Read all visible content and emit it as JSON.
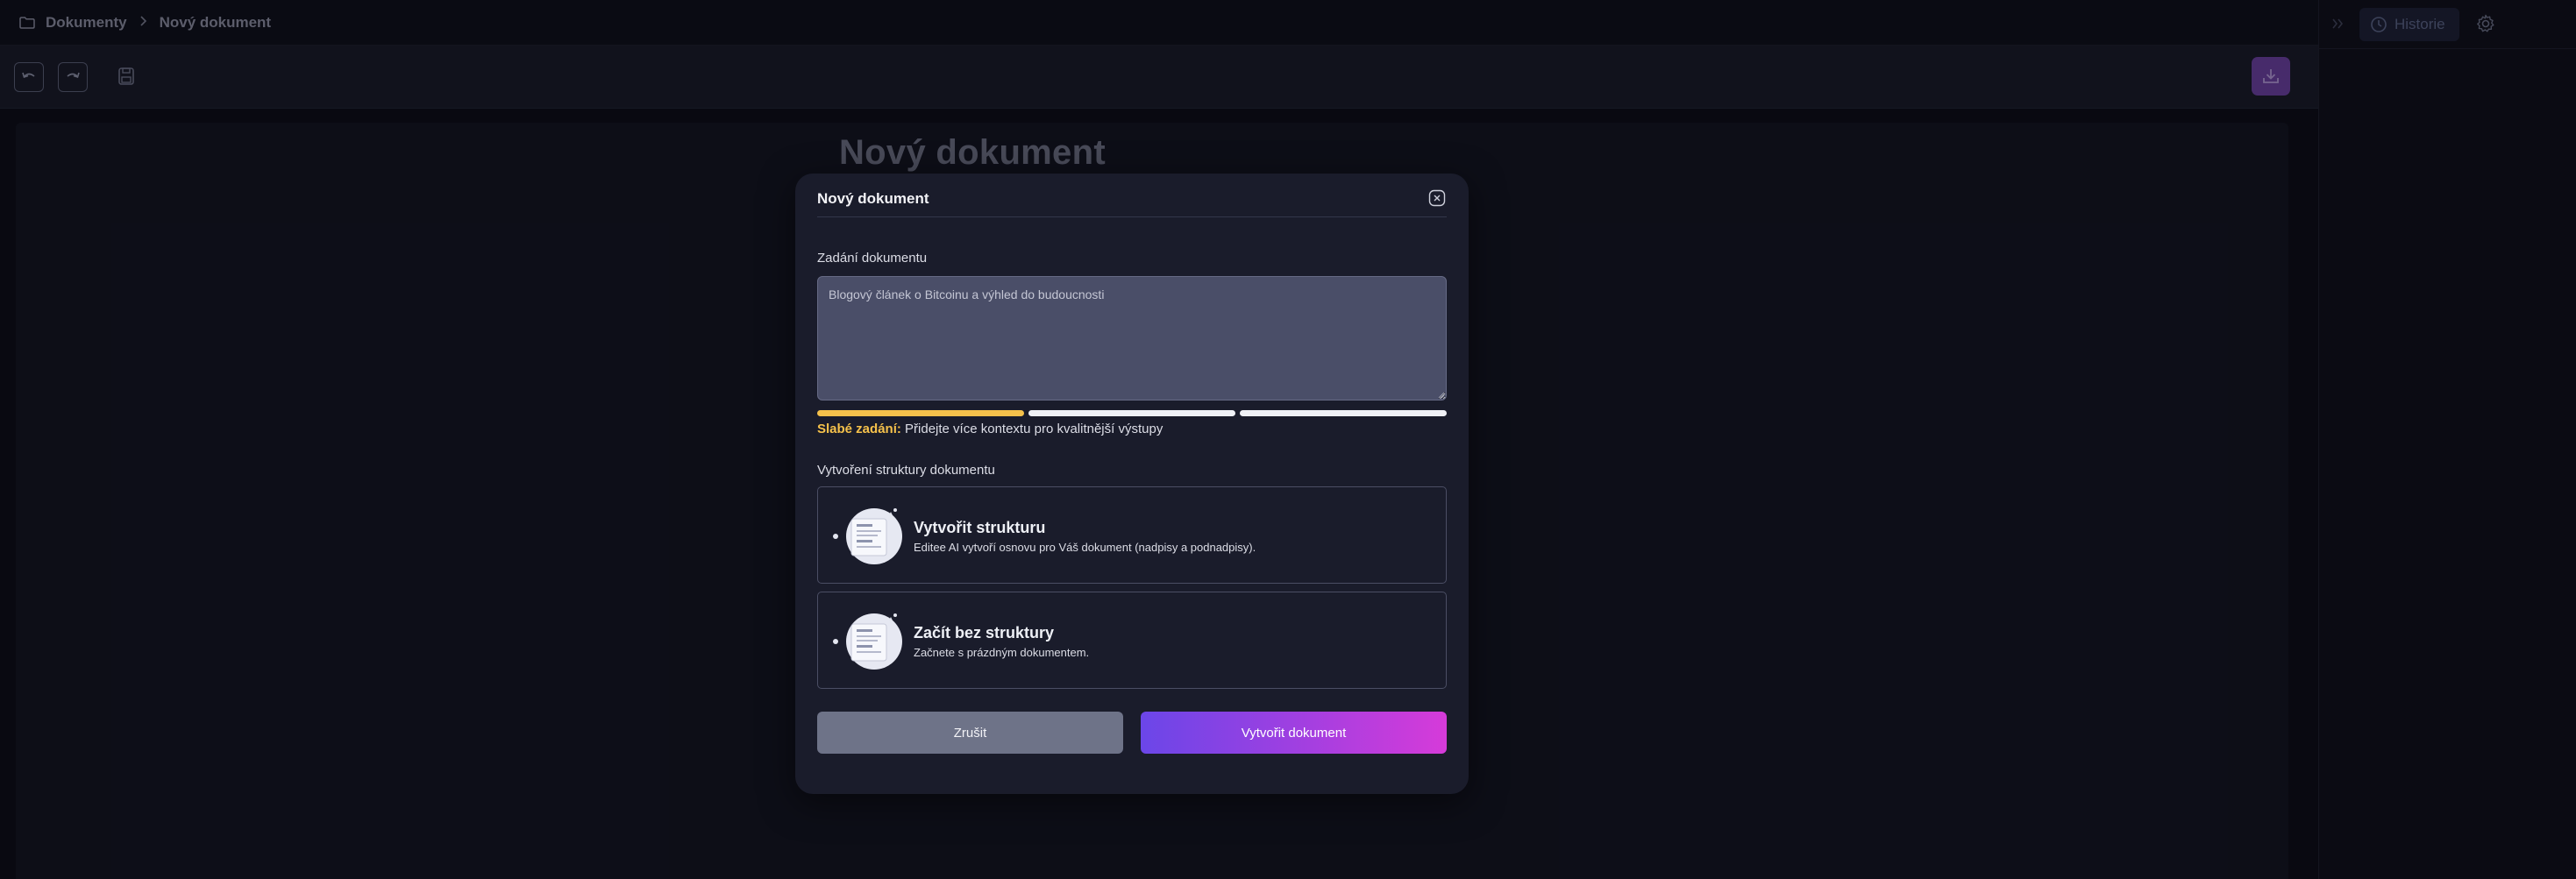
{
  "breadcrumb": {
    "root": "Dokumenty",
    "current": "Nový dokument"
  },
  "toolbar": {
    "undo_icon": "undo-icon",
    "redo_icon": "redo-icon",
    "save_icon": "save-icon",
    "download_icon": "download-icon",
    "download_color": "#6a3f9e"
  },
  "document": {
    "title": "Nový dokument"
  },
  "right_panel": {
    "history_label": "Historie"
  },
  "modal": {
    "title": "Nový dokument",
    "prompt_label": "Zadání dokumentu",
    "prompt_value": "Blogový článek o Bitcoinu a výhled do budoucnosti",
    "strength": {
      "segments_total": 3,
      "segments_filled": 1,
      "level_label": "Slabé zadání:",
      "message": " Přidejte více kontextu pro kvalitnější výstupy",
      "color": "#f5c14b"
    },
    "structure_label": "Vytvoření struktury dokumentu",
    "options": [
      {
        "title": "Vytvořit strukturu",
        "description": "Editee AI vytvoří osnovu pro Váš dokument (nadpisy a podnadpisy)."
      },
      {
        "title": "Začít bez struktury",
        "description": "Začnete s prázdným dokumentem."
      }
    ],
    "cancel_label": "Zrušit",
    "create_label": "Vytvořit dokument",
    "accent_gradient": [
      "#6b46e8",
      "#d63bd9"
    ]
  }
}
